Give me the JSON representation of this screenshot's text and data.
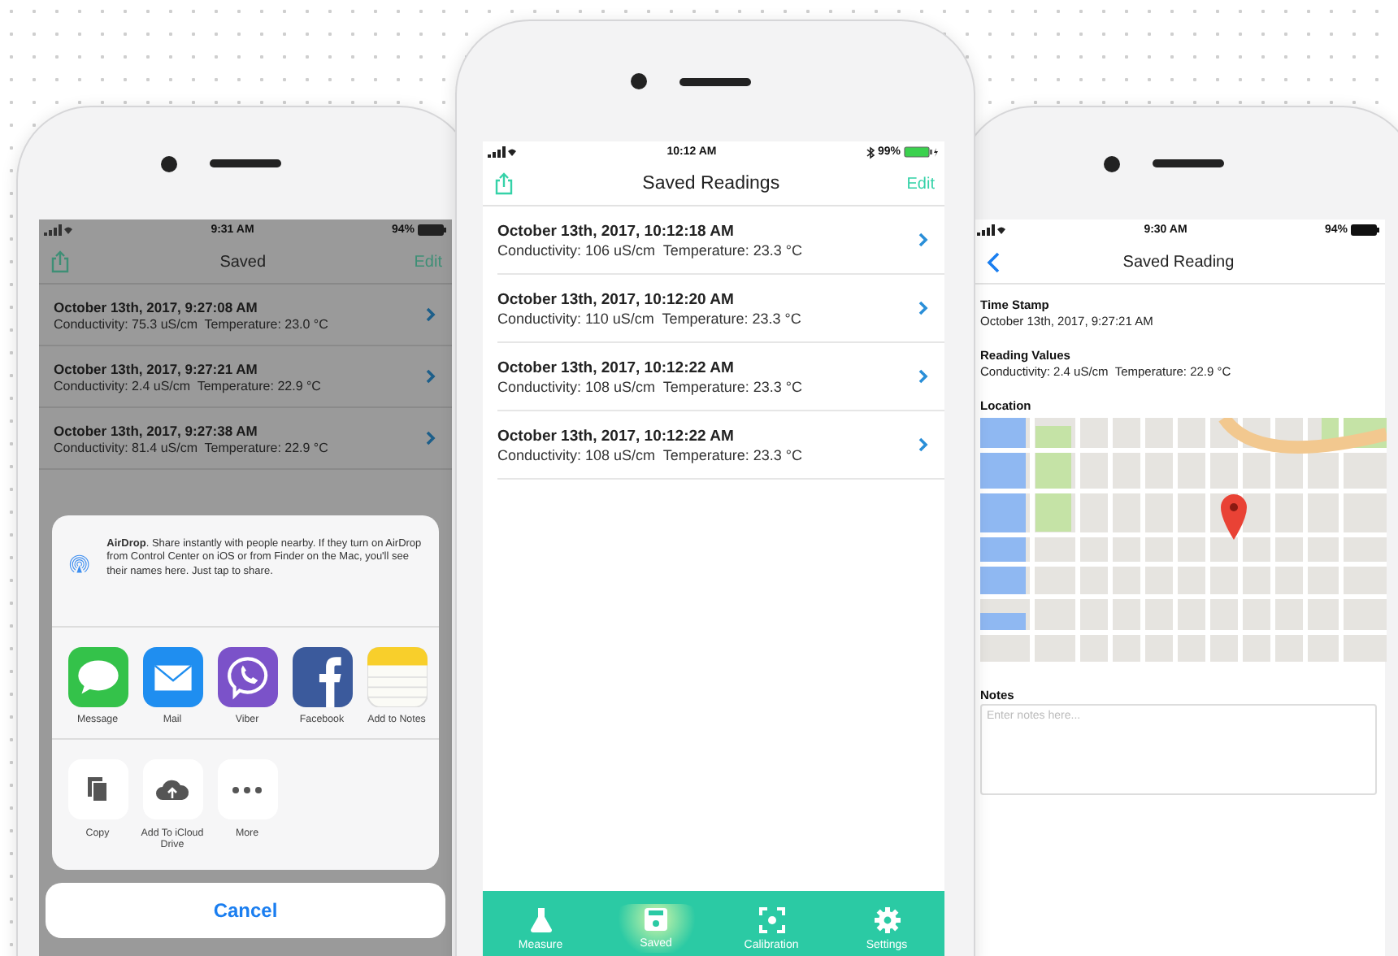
{
  "left_phone": {
    "status_bar": {
      "time": "9:31 AM",
      "battery": "94%"
    },
    "nav": {
      "title": "Saved",
      "action": "Edit"
    },
    "readings": [
      {
        "timestamp": "October 13th, 2017, 9:27:08 AM",
        "values": "Conductivity: 75.3 uS/cm  Temperature: 23.0 °C"
      },
      {
        "timestamp": "October 13th, 2017, 9:27:21 AM",
        "values": "Conductivity: 2.4 uS/cm  Temperature: 22.9 °C"
      },
      {
        "timestamp": "October 13th, 2017, 9:27:38 AM",
        "values": "Conductivity: 81.4 uS/cm  Temperature: 22.9 °C"
      }
    ],
    "share_sheet": {
      "airdrop_text": "**AirDrop**. Share instantly with people nearby. If they turn on AirDrop from Control Center on iOS or from Finder on the Mac, you'll see their names here. Just tap to share.",
      "apps": [
        {
          "kind": "message",
          "label": "Message"
        },
        {
          "kind": "mail",
          "label": "Mail"
        },
        {
          "kind": "viber",
          "label": "Viber"
        },
        {
          "kind": "facebook",
          "label": "Facebook"
        },
        {
          "kind": "notes",
          "label": "Add to Notes"
        }
      ],
      "actions": [
        {
          "kind": "copy",
          "label": "Copy"
        },
        {
          "kind": "icloud",
          "label": "Add To iCloud Drive"
        },
        {
          "kind": "more",
          "label": "More"
        }
      ],
      "cancel": "Cancel"
    }
  },
  "center_phone": {
    "status_bar": {
      "time": "10:12 AM",
      "battery": "99%"
    },
    "nav": {
      "title": "Saved Readings",
      "action": "Edit"
    },
    "readings": [
      {
        "timestamp": "October 13th, 2017, 10:12:18 AM",
        "values": "Conductivity: 106 uS/cm  Temperature: 23.3 °C"
      },
      {
        "timestamp": "October 13th, 2017, 10:12:20 AM",
        "values": "Conductivity: 110 uS/cm  Temperature: 23.3 °C"
      },
      {
        "timestamp": "October 13th, 2017, 10:12:22 AM",
        "values": "Conductivity: 108 uS/cm  Temperature: 23.3 °C"
      },
      {
        "timestamp": "October 13th, 2017, 10:12:22 AM",
        "values": "Conductivity: 108 uS/cm  Temperature: 23.3 °C"
      }
    ],
    "tabs": [
      {
        "kind": "measure",
        "label": "Measure",
        "selected": false
      },
      {
        "kind": "saved",
        "label": "Saved",
        "selected": true
      },
      {
        "kind": "calibration",
        "label": "Calibration",
        "selected": false
      },
      {
        "kind": "settings",
        "label": "Settings",
        "selected": false
      }
    ]
  },
  "right_phone": {
    "status_bar": {
      "time": "9:30 AM",
      "battery": "94%"
    },
    "nav": {
      "title": "Saved Reading"
    },
    "sections": [
      {
        "heading": "Time Stamp",
        "value": "October 13th, 2017, 9:27:21 AM"
      },
      {
        "heading": "Reading Values",
        "value": "Conductivity: 2.4 uS/cm  Temperature: 22.9 °C"
      }
    ],
    "location_heading": "Location",
    "notes": {
      "heading": "Notes",
      "placeholder": "Enter notes here..."
    }
  }
}
